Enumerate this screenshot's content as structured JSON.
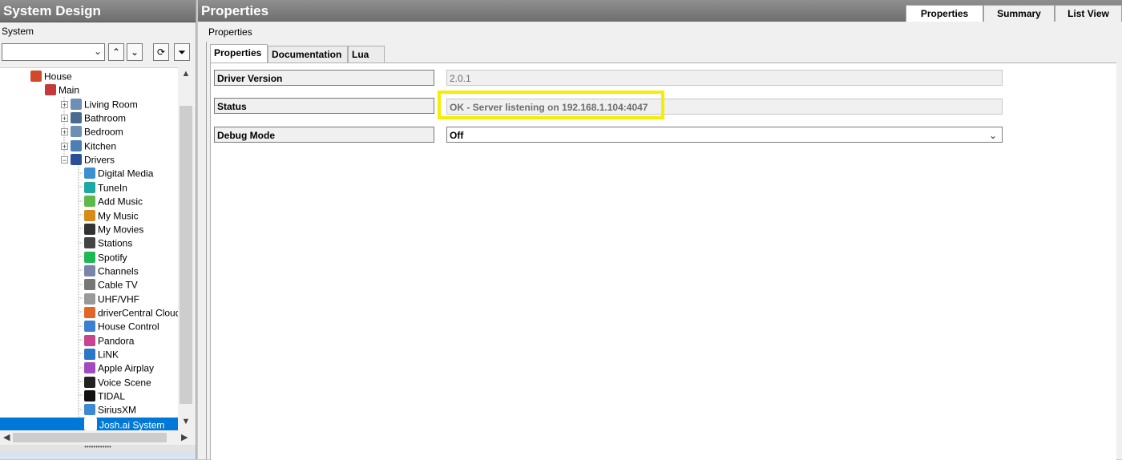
{
  "left": {
    "title": "System Design",
    "subtitle": "System",
    "toolbar": {
      "combo_value": "",
      "up": "⌃",
      "down": "⌄",
      "refresh": "⟳",
      "filter": "⏷"
    },
    "tree": [
      {
        "label": "House",
        "level": 0,
        "icon": "house-icon",
        "color": "#d04a2a"
      },
      {
        "label": "Main",
        "level": 1,
        "icon": "building-icon",
        "color": "#c43a3a"
      },
      {
        "label": "Living Room",
        "level": 2,
        "icon": "room-icon",
        "color": "#6e8fb5"
      },
      {
        "label": "Bathroom",
        "level": 2,
        "icon": "room-icon",
        "color": "#4b6a8f"
      },
      {
        "label": "Bedroom",
        "level": 2,
        "icon": "room-icon",
        "color": "#6e8fb5"
      },
      {
        "label": "Kitchen",
        "level": 2,
        "icon": "room-icon",
        "color": "#4b7fb5"
      },
      {
        "label": "Drivers",
        "level": 2,
        "icon": "drivers-icon",
        "color": "#2b4e9a"
      },
      {
        "label": "Digital Media",
        "level": 3,
        "icon": "media-icon",
        "color": "#3b8fd0"
      },
      {
        "label": "TuneIn",
        "level": 3,
        "icon": "tunein-icon",
        "color": "#1ca9a3"
      },
      {
        "label": "Add Music",
        "level": 3,
        "icon": "music-icon",
        "color": "#5fb84a"
      },
      {
        "label": "My Music",
        "level": 3,
        "icon": "mymusic-icon",
        "color": "#d88a1b"
      },
      {
        "label": "My Movies",
        "level": 3,
        "icon": "movies-icon",
        "color": "#333333"
      },
      {
        "label": "Stations",
        "level": 3,
        "icon": "stations-icon",
        "color": "#444444"
      },
      {
        "label": "Spotify",
        "level": 3,
        "icon": "spotify-icon",
        "color": "#1db954"
      },
      {
        "label": "Channels",
        "level": 3,
        "icon": "channels-icon",
        "color": "#7a86a8"
      },
      {
        "label": "Cable TV",
        "level": 3,
        "icon": "cable-icon",
        "color": "#777777"
      },
      {
        "label": "UHF/VHF",
        "level": 3,
        "icon": "antenna-icon",
        "color": "#999999"
      },
      {
        "label": "driverCentral Cloud",
        "level": 3,
        "icon": "cloud-icon",
        "color": "#e0662a"
      },
      {
        "label": "House Control",
        "level": 3,
        "icon": "housecontrol-icon",
        "color": "#3a7fd0"
      },
      {
        "label": "Pandora",
        "level": 3,
        "icon": "pandora-icon",
        "color": "#c9448f"
      },
      {
        "label": "LiNK",
        "level": 3,
        "icon": "link-icon",
        "color": "#2a76c8"
      },
      {
        "label": "Apple Airplay",
        "level": 3,
        "icon": "airplay-icon",
        "color": "#a24bc0"
      },
      {
        "label": "Voice Scene",
        "level": 3,
        "icon": "microphone-icon",
        "color": "#222222"
      },
      {
        "label": "TIDAL",
        "level": 3,
        "icon": "tidal-icon",
        "color": "#111111"
      },
      {
        "label": "SiriusXM",
        "level": 3,
        "icon": "siriusxm-icon",
        "color": "#3c8ad4"
      },
      {
        "label": "Josh.ai System",
        "level": 3,
        "icon": "joshai-icon",
        "color": "#ffffff",
        "selected": true
      }
    ]
  },
  "right": {
    "title": "Properties",
    "tabs": [
      "Properties",
      "Summary",
      "List View"
    ],
    "active_tab": "Properties",
    "breadcrumb": "Properties",
    "inner_tabs": [
      "Properties",
      "Documentation",
      "Lua"
    ],
    "properties": [
      {
        "label": "Driver Version",
        "value": "2.0.1"
      },
      {
        "label": "Status",
        "value": "OK - Server listening on 192.168.1.104:4047"
      },
      {
        "label": "Debug Mode",
        "value": "Off",
        "dropdown": true
      }
    ],
    "highlight_color": "#f5ee00"
  },
  "colors": {
    "selection": "#0078d7",
    "title_bar": "#7a7a7a"
  }
}
